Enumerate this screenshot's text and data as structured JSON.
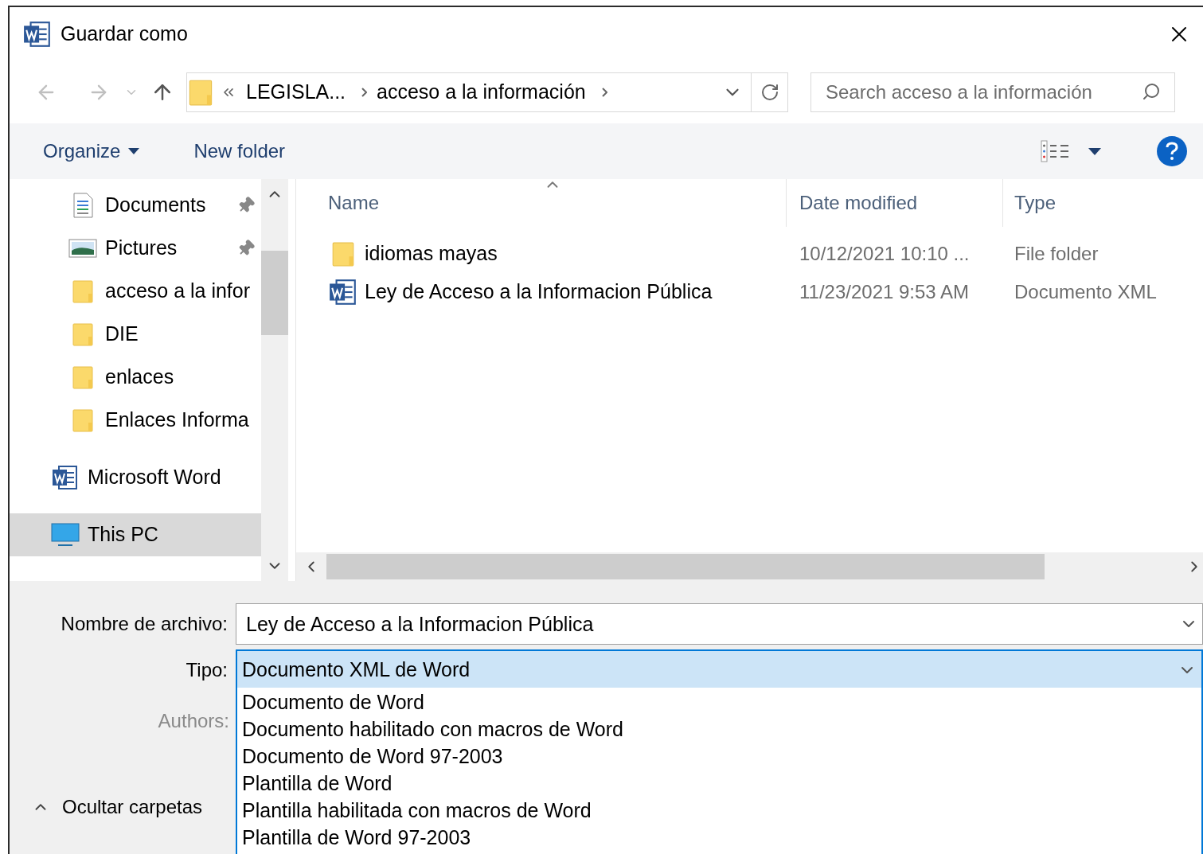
{
  "window": {
    "title": "Guardar como"
  },
  "navigation": {
    "back": {
      "disabled": true
    },
    "forward": {
      "disabled": true
    },
    "up": {
      "disabled": false
    }
  },
  "address": {
    "crumbs": [
      "LEGISLA...",
      "acceso a la información"
    ]
  },
  "search": {
    "placeholder": "Search acceso a la información"
  },
  "toolbar": {
    "organize": "Organize",
    "new_folder": "New folder"
  },
  "sidebar": {
    "items": [
      {
        "label": "Documents",
        "kind": "documents",
        "pinned": true,
        "selected": false
      },
      {
        "label": "Pictures",
        "kind": "pictures",
        "pinned": true,
        "selected": false
      },
      {
        "label": "acceso a la infor",
        "kind": "folder",
        "pinned": false,
        "selected": false
      },
      {
        "label": "DIE",
        "kind": "folder",
        "pinned": false,
        "selected": false
      },
      {
        "label": "enlaces",
        "kind": "folder",
        "pinned": false,
        "selected": false
      },
      {
        "label": "Enlaces Informa",
        "kind": "folder",
        "pinned": false,
        "selected": false
      },
      {
        "label": "Microsoft Word",
        "kind": "word",
        "pinned": false,
        "selected": false
      },
      {
        "label": "This PC",
        "kind": "pc",
        "pinned": false,
        "selected": true
      }
    ]
  },
  "file_list": {
    "columns": [
      "Name",
      "Date modified",
      "Type"
    ],
    "rows": [
      {
        "name": "idiomas mayas",
        "date": "10/12/2021 10:10 ...",
        "type": "File folder",
        "kind": "folder"
      },
      {
        "name": "Ley de Acceso a la Informacion Pública",
        "date": "11/23/2021 9:53 AM",
        "type": "Documento XML",
        "kind": "word"
      }
    ]
  },
  "form": {
    "filename_label": "Nombre de archivo:",
    "filename": "Ley de Acceso a la Informacion Pública",
    "type_label": "Tipo:",
    "type": "Documento XML de Word",
    "type_focused": true,
    "authors_label": "Authors:"
  },
  "type_options": [
    "Documento de Word",
    "Documento habilitado con macros de Word",
    "Documento de Word 97-2003",
    "Plantilla de Word",
    "Plantilla habilitada con macros de Word",
    "Plantilla de Word 97-2003"
  ],
  "hide_folders": "Ocultar carpetas"
}
